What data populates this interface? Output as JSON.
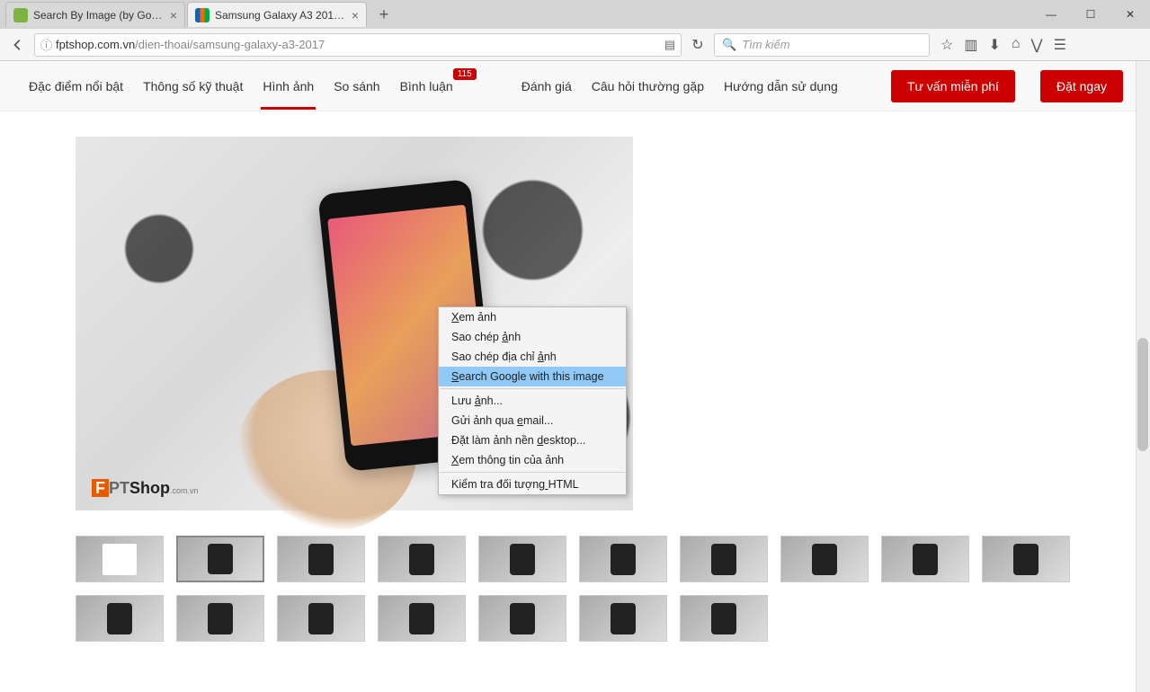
{
  "tabs": [
    {
      "title": "Search By Image (by Goog...",
      "icon_color": "#7cb342"
    },
    {
      "title": "Samsung Galaxy A3 2017 c...",
      "icon_color": "#ff6600"
    }
  ],
  "url": {
    "host": "fptshop.com.vn",
    "path": "/dien-thoai/samsung-galaxy-a3-2017"
  },
  "search_placeholder": "Tìm kiếm",
  "page_nav": {
    "items": [
      "Đặc điểm nổi bật",
      "Thông số kỹ thuật",
      "Hình ảnh",
      "So sánh",
      "Bình luận",
      "Đánh giá",
      "Câu hỏi thường gặp",
      "Hướng dẫn sử dụng"
    ],
    "active_index": 2,
    "badge_index": 4,
    "badge_value": "115",
    "btn_consult": "Tư vấn miễn phí",
    "btn_order": "Đặt ngay"
  },
  "watermark": {
    "brand1": "F",
    "brand2": "PT",
    "brand3": "Shop",
    "suffix": ".com.vn"
  },
  "context_menu": {
    "groups": [
      [
        "Xem ảnh",
        "Sao chép ảnh",
        "Sao chép địa chỉ ảnh",
        "Search Google with this image"
      ],
      [
        "Lưu ảnh...",
        "Gửi ảnh qua email...",
        "Đặt làm ảnh nền desktop...",
        "Xem thông tin của ảnh"
      ],
      [
        "Kiểm tra đối tượng HTML"
      ]
    ],
    "highlighted": "Search Google with this image"
  },
  "thumb_count": 17
}
